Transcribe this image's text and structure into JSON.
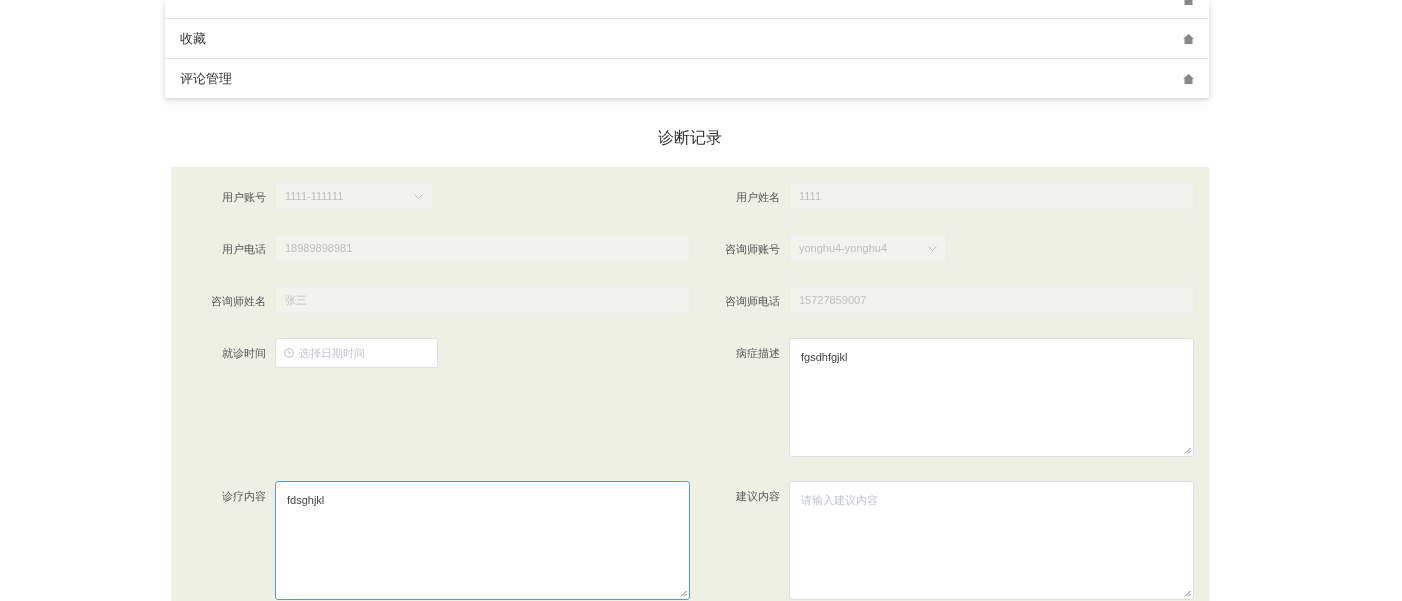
{
  "menu": {
    "items": [
      {
        "clipped": true
      },
      {
        "label": "收藏",
        "clipped": false
      },
      {
        "label": "评论管理",
        "clipped": false
      }
    ]
  },
  "form": {
    "title": "诊断记录",
    "rows": [
      [
        {
          "label": "用户账号",
          "kind": "select",
          "value": "1111-111111",
          "disabled": true
        },
        {
          "label": "用户姓名",
          "kind": "input",
          "value": "1111",
          "disabled": true
        }
      ],
      [
        {
          "label": "用户电话",
          "kind": "input",
          "value": "18989898981",
          "disabled": true
        },
        {
          "label": "咨询师账号",
          "kind": "select",
          "value": "yonghu4-yonghu4",
          "disabled": true
        }
      ],
      [
        {
          "label": "咨询师姓名",
          "kind": "input",
          "value": "张三",
          "disabled": true
        },
        {
          "label": "咨询师电话",
          "kind": "input",
          "value": "15727859007",
          "disabled": true
        }
      ],
      [
        {
          "label": "就诊时间",
          "kind": "date",
          "placeholder": "选择日期时间",
          "disabled": false
        },
        {
          "label": "病症描述",
          "kind": "textarea",
          "value": "fgsdhfgjkl",
          "disabled": false,
          "focused": false
        }
      ],
      [
        {
          "label": "诊疗内容",
          "kind": "textarea",
          "value": "fdsghjkl",
          "disabled": false,
          "focused": true
        },
        {
          "label": "建议内容",
          "kind": "textarea",
          "placeholder": "请输入建议内容",
          "disabled": false,
          "focused": false
        }
      ]
    ]
  }
}
